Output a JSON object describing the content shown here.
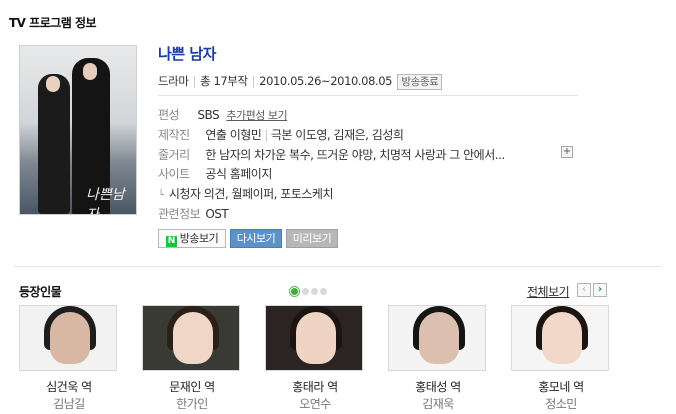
{
  "section": {
    "title": "TV 프로그램 정보"
  },
  "show": {
    "title": "나쁜 남자",
    "genre": "드라마",
    "episodes": "총 17부작",
    "dates": "2010.05.26~2010.08.05",
    "status_badge": "방송종료",
    "poster_logo": "나쁜남자"
  },
  "info": {
    "network_label": "편성",
    "network_value": "SBS",
    "network_more": "추가편성 보기",
    "crew_label": "제작진",
    "director": "연출 이형민",
    "writers": "극본 이도영, 김재은, 김성희",
    "synopsis_label": "줄거리",
    "synopsis": "한 남자의 차가운 복수, 뜨거운 야망, 치명적 사랑과 그 안에서...",
    "synopsis_more": "+",
    "site_label": "사이트",
    "site_value": "공식 홈페이지",
    "site_sub_arrow": "└",
    "site_sub": "시청자 의견, 월페이퍼, 포토스케치",
    "related_label": "관련정보",
    "related_value": "OST"
  },
  "buttons": {
    "watch_icon": "N",
    "watch": "방송보기",
    "replay": "다시보기",
    "preview": "미리보기"
  },
  "cast_section": {
    "title": "등장인물",
    "view_all": "전체보기",
    "prev": "‹",
    "next": "›",
    "page_count": 4,
    "active_page": 1
  },
  "cast": [
    {
      "role": "심건욱 역",
      "actor": "김남길",
      "hair": "#1e1e1e",
      "skin": "#d8b8a4",
      "bg": "#f2f2f2"
    },
    {
      "role": "문재인 역",
      "actor": "한가인",
      "hair": "#2b1f18",
      "skin": "#f0d6c6",
      "bg": "#3a3a35"
    },
    {
      "role": "홍태라 역",
      "actor": "오연수",
      "hair": "#1a1412",
      "skin": "#efd3c3",
      "bg": "#2c2422"
    },
    {
      "role": "홍태성 역",
      "actor": "김재욱",
      "hair": "#151515",
      "skin": "#dcbfae",
      "bg": "#f4f4f4"
    },
    {
      "role": "홍모네 역",
      "actor": "정소민",
      "hair": "#1c140f",
      "skin": "#f2d8c8",
      "bg": "#f5f5f5"
    }
  ]
}
